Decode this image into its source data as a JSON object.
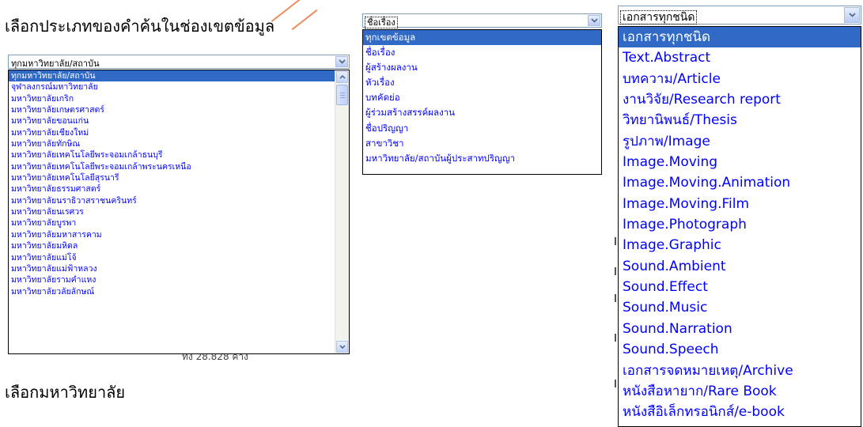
{
  "captions": {
    "field_type": "เลือกประเภทของคำค้นในช่องเขตข้อมูล",
    "university": "เลือกมหาวิทยาลัย"
  },
  "university_select": {
    "selected": "ทุกมหาวิทยาลัย/สถาบัน",
    "options": [
      "ทุกมหาวิทยาลัย/สถาบัน",
      "จุฬาลงกรณ์มหาวิทยาลัย",
      "มหาวิทยาลัยเกริก",
      "มหาวิทยาลัยเกษตรศาสตร์",
      "มหาวิทยาลัยขอนแก่น",
      "มหาวิทยาลัยเชียงใหม่",
      "มหาวิทยาลัยทักษิณ",
      "มหาวิทยาลัยเทคโนโลยีพระจอมเกล้าธนบุรี",
      "มหาวิทยาลัยเทคโนโลยีพระจอมเกล้าพระนครเหนือ",
      "มหาวิทยาลัยเทคโนโลยีสุรนารี",
      "มหาวิทยาลัยธรรมศาสตร์",
      "มหาวิทยาลัยนราธิวาสราชนครินทร์",
      "มหาวิทยาลัยนเรศวร",
      "มหาวิทยาลัยบูรพา",
      "มหาวิทยาลัยมหาสารคาม",
      "มหาวิทยาลัยมหิดล",
      "มหาวิทยาลัยแม่โจ้",
      "มหาวิทยาลัยแม่ฟ้าหลวง",
      "มหาวิทยาลัยรามคำแหง",
      "มหาวิทยาลัยวลัยลักษณ์"
    ]
  },
  "field_select": {
    "selected": "ชื่อเรื่อง",
    "options": [
      "ทุกเขตข้อมูล",
      "ชื่อเรื่อง",
      "ผู้สร้างผลงาน",
      "หัวเรื่อง",
      "บทคัดย่อ",
      "ผู้ร่วมสร้างสรรค์ผลงาน",
      "ชื่อปริญญา",
      "สาขาวิชา",
      "มหาวิทยาลัย/สถาบันผู้ประสาทปริญญา"
    ]
  },
  "doctype_select": {
    "selected": "เอกสารทุกชนิด",
    "options": [
      "เอกสารทุกชนิด",
      "Text.Abstract",
      "บทความ/Article",
      "งานวิจัย/Research report",
      "วิทยานิพนธ์/Thesis",
      "รูปภาพ/Image",
      "Image.Moving",
      "Image.Moving.Animation",
      "Image.Moving.Film",
      "Image.Photograph",
      "Image.Graphic",
      "Sound.Ambient",
      "Sound.Effect",
      "Sound.Music",
      "Sound.Narration",
      "Sound.Speech",
      "เอกสารจดหมายเหตุ/Archive",
      "หนังสือหายาก/Rare Book",
      "หนังสือิเล็กทรอนิกส์/e-book"
    ]
  },
  "background": {
    "partial_count": "ทั้ง 28.828 ค่าง"
  },
  "colors": {
    "highlight": "#3169c6",
    "option_text": "#0000ff",
    "border": "#7f9db9"
  }
}
